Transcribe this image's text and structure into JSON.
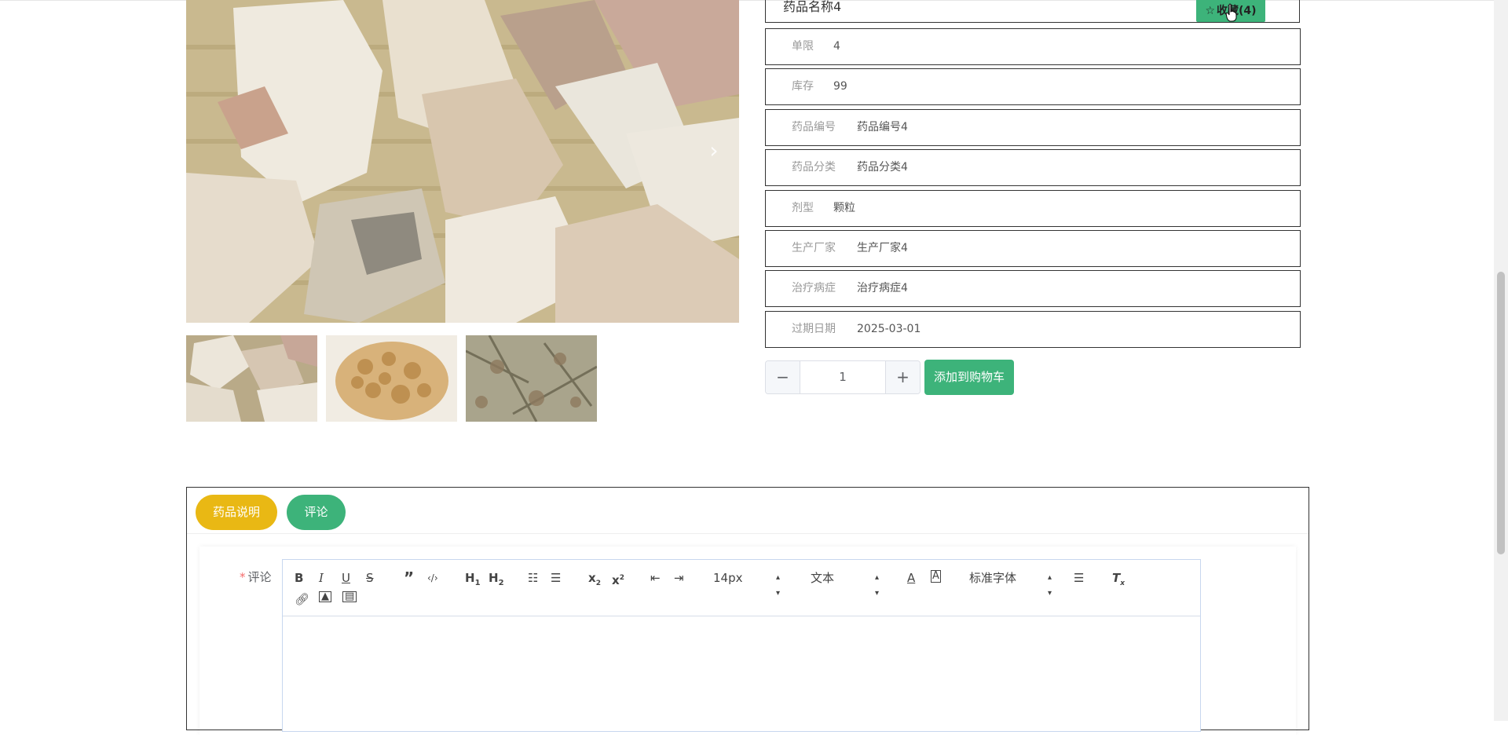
{
  "product": {
    "name": "药品名称4",
    "favorite_label": "收藏(4)"
  },
  "details": [
    {
      "label": "单限",
      "value": "4"
    },
    {
      "label": "库存",
      "value": "99"
    },
    {
      "label": "药品编号",
      "value": "药品编号4"
    },
    {
      "label": "药品分类",
      "value": "药品分类4"
    },
    {
      "label": "剂型",
      "value": "颗粒"
    },
    {
      "label": "生产厂家",
      "value": "生产厂家4"
    },
    {
      "label": "治疗病症",
      "value": "治疗病症4"
    },
    {
      "label": "过期日期",
      "value": "2025-03-01"
    }
  ],
  "quantity": {
    "minus": "−",
    "value": "1",
    "plus": "+"
  },
  "cart_button": "添加到购物车",
  "gallery": {
    "next_icon": "chevron-right-icon"
  },
  "tabs": [
    {
      "label": "药品说明",
      "color": "#e9b814"
    },
    {
      "label": "评论",
      "color": "#3db37a"
    }
  ],
  "comment_form": {
    "required_mark": "*",
    "label": "评论",
    "font_size_value": "14px",
    "text_type_value": "文本",
    "font_family_value": "标准字体"
  },
  "colors": {
    "accent": "#3db37a",
    "tab_yellow": "#e9b814"
  }
}
